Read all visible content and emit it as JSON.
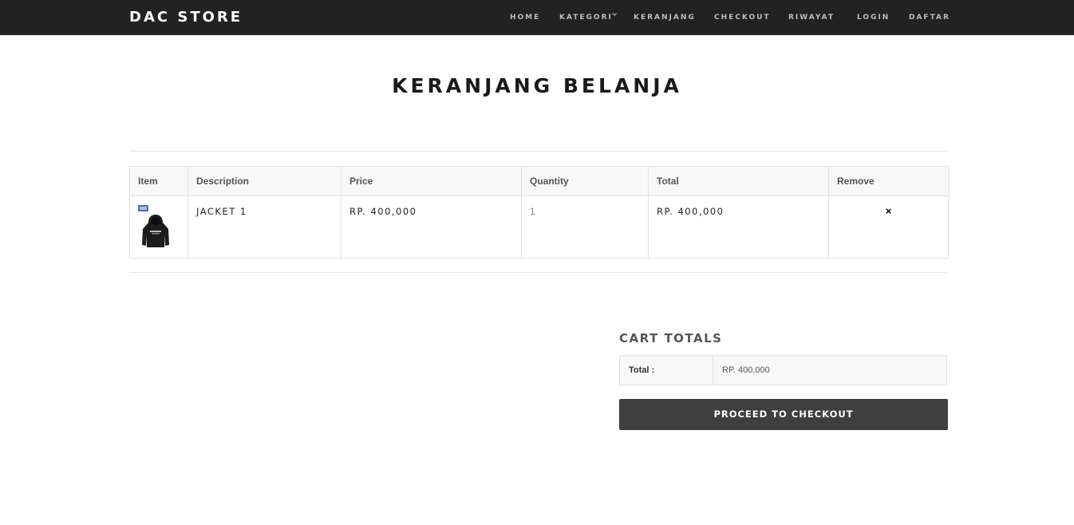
{
  "navbar": {
    "brand": "DAC STORE",
    "items": [
      {
        "label": "HOME"
      },
      {
        "label": "KATEGORI"
      },
      {
        "label": "KERANJANG"
      },
      {
        "label": "CHECKOUT"
      },
      {
        "label": "RIWAYAT"
      },
      {
        "label": "LOGIN"
      },
      {
        "label": "DAFTAR"
      }
    ]
  },
  "page": {
    "title": "KERANJANG BELANJA"
  },
  "cart": {
    "headers": [
      "Item",
      "Description",
      "Price",
      "Quantity",
      "Total",
      "Remove"
    ],
    "rows": [
      {
        "image_icon": "hoodie-product-image",
        "description": "JACKET 1",
        "price": "RP. 400,000",
        "quantity": "1",
        "total": "RP. 400,000",
        "remove": "×"
      }
    ]
  },
  "totals": {
    "title": "CART TOTALS",
    "label": "Total :",
    "value": "RP. 400,000",
    "checkout_button": "PROCEED TO CHECKOUT"
  },
  "colors": {
    "navbar_bg": "#222222",
    "button_bg": "#3f3f3f",
    "table_header_bg": "#f8f8f8"
  }
}
